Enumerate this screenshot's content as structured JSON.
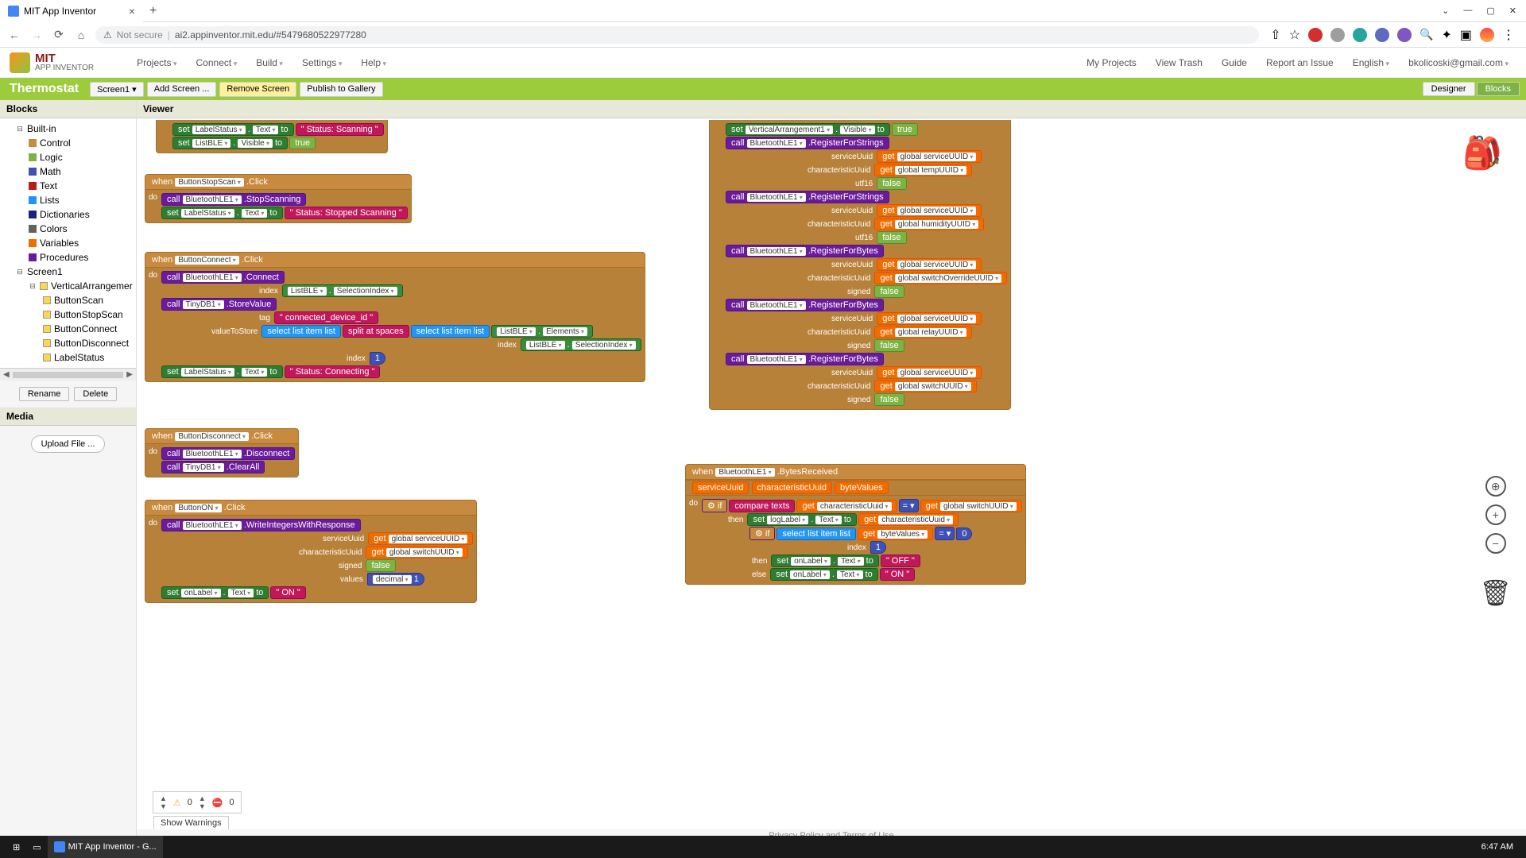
{
  "browser": {
    "tab_title": "MIT App Inventor",
    "url_prefix": "Not secure",
    "url": "ai2.appinventor.mit.edu/#5479680522977280"
  },
  "logo": {
    "line1": "MIT",
    "line2": "APP INVENTOR"
  },
  "menu": {
    "projects": "Projects",
    "connect": "Connect",
    "build": "Build",
    "settings": "Settings",
    "help": "Help"
  },
  "topright": {
    "myprojects": "My Projects",
    "viewtrash": "View Trash",
    "guide": "Guide",
    "report": "Report an Issue",
    "english": "English",
    "account": "bkolicoski@gmail.com"
  },
  "project_name": "Thermostat",
  "screenbtns": {
    "screen": "Screen1",
    "add": "Add Screen ...",
    "remove": "Remove Screen",
    "publish": "Publish to Gallery"
  },
  "mode": {
    "designer": "Designer",
    "blocks": "Blocks"
  },
  "panels": {
    "blocks": "Blocks",
    "viewer": "Viewer",
    "media": "Media"
  },
  "builtin": {
    "root": "Built-in",
    "control": "Control",
    "logic": "Logic",
    "math": "Math",
    "text": "Text",
    "lists": "Lists",
    "dict": "Dictionaries",
    "colors": "Colors",
    "vars": "Variables",
    "proc": "Procedures"
  },
  "screen_tree": {
    "screen1": "Screen1",
    "va": "VerticalArrangemer",
    "scan": "ButtonScan",
    "stop": "ButtonStopScan",
    "conn": "ButtonConnect",
    "disc": "ButtonDisconnect",
    "label": "LabelStatus"
  },
  "sidebtn": {
    "rename": "Rename",
    "delete": "Delete",
    "upload": "Upload File ..."
  },
  "warn": {
    "show": "Show Warnings",
    "w": "0",
    "e": "0"
  },
  "footer": "Privacy Policy and Terms of Use",
  "taskbar": {
    "app": "MIT App Inventor - G...",
    "time": "6:47 AM"
  },
  "kw": {
    "when": "when",
    "do": "do",
    "call": "call",
    "set": "set",
    "to": "to",
    "get": "get",
    "text": "Text",
    "visible": "Visible",
    "click": ".Click",
    "index": "index",
    "tag": "tag",
    "valuetostore": "valueToStore",
    "servuuid": "serviceUuid",
    "charuuid": "characteristicUuid",
    "utf16": "utf16",
    "signed": "signed",
    "values": "values",
    "if": "if",
    "then": "then",
    "else": "else",
    "decimal": "decimal",
    "list": "list"
  },
  "comp": {
    "labelstatus": "LabelStatus",
    "listble": "ListBLE",
    "ble": "BluetoothLE1",
    "tinydb": "TinyDB1",
    "va1": "VerticalArrangement1",
    "onlabel": "onLabel",
    "loglabel": "logLabel"
  },
  "meth": {
    "stopscan": ".StopScanning",
    "connect": ".Connect",
    "disconnect": ".Disconnect",
    "storevalue": ".StoreValue",
    "clearall": ".ClearAll",
    "writeints": ".WriteIntegersWithResponse",
    "regstr": ".RegisterForStrings",
    "regbytes": ".RegisterForBytes",
    "bytesrecv": ".BytesReceived",
    "selectionindex": "SelectionIndex",
    "elements": "Elements"
  },
  "btn": {
    "stopscan": "ButtonStopScan",
    "connect": "ButtonConnect",
    "disconnect": "ButtonDisconnect",
    "on": "ButtonON"
  },
  "txt": {
    "scanning": "\" Status: Scanning \"",
    "stopped": "\" Status: Stopped Scanning \"",
    "connecting": "\" Status: Connecting \"",
    "connid": "\" connected_device_id \"",
    "on": "\" ON \"",
    "off": "\" OFF \"",
    "split": "split at spaces",
    "selectitem": "select list item  list",
    "compare": "compare texts"
  },
  "bool": {
    "true": "true",
    "false": "false"
  },
  "num": {
    "one": "1",
    "zero": "0"
  },
  "glob": {
    "serv": "global serviceUUID",
    "temp": "global tempUUID",
    "humid": "global humidityUUID",
    "switchov": "global switchOverrideUUID",
    "relay": "global relayUUID",
    "switch": "global switchUUID"
  },
  "param": {
    "servuuid": "serviceUuid",
    "charuuid": "characteristicUuid",
    "bytevals": "byteValues"
  }
}
